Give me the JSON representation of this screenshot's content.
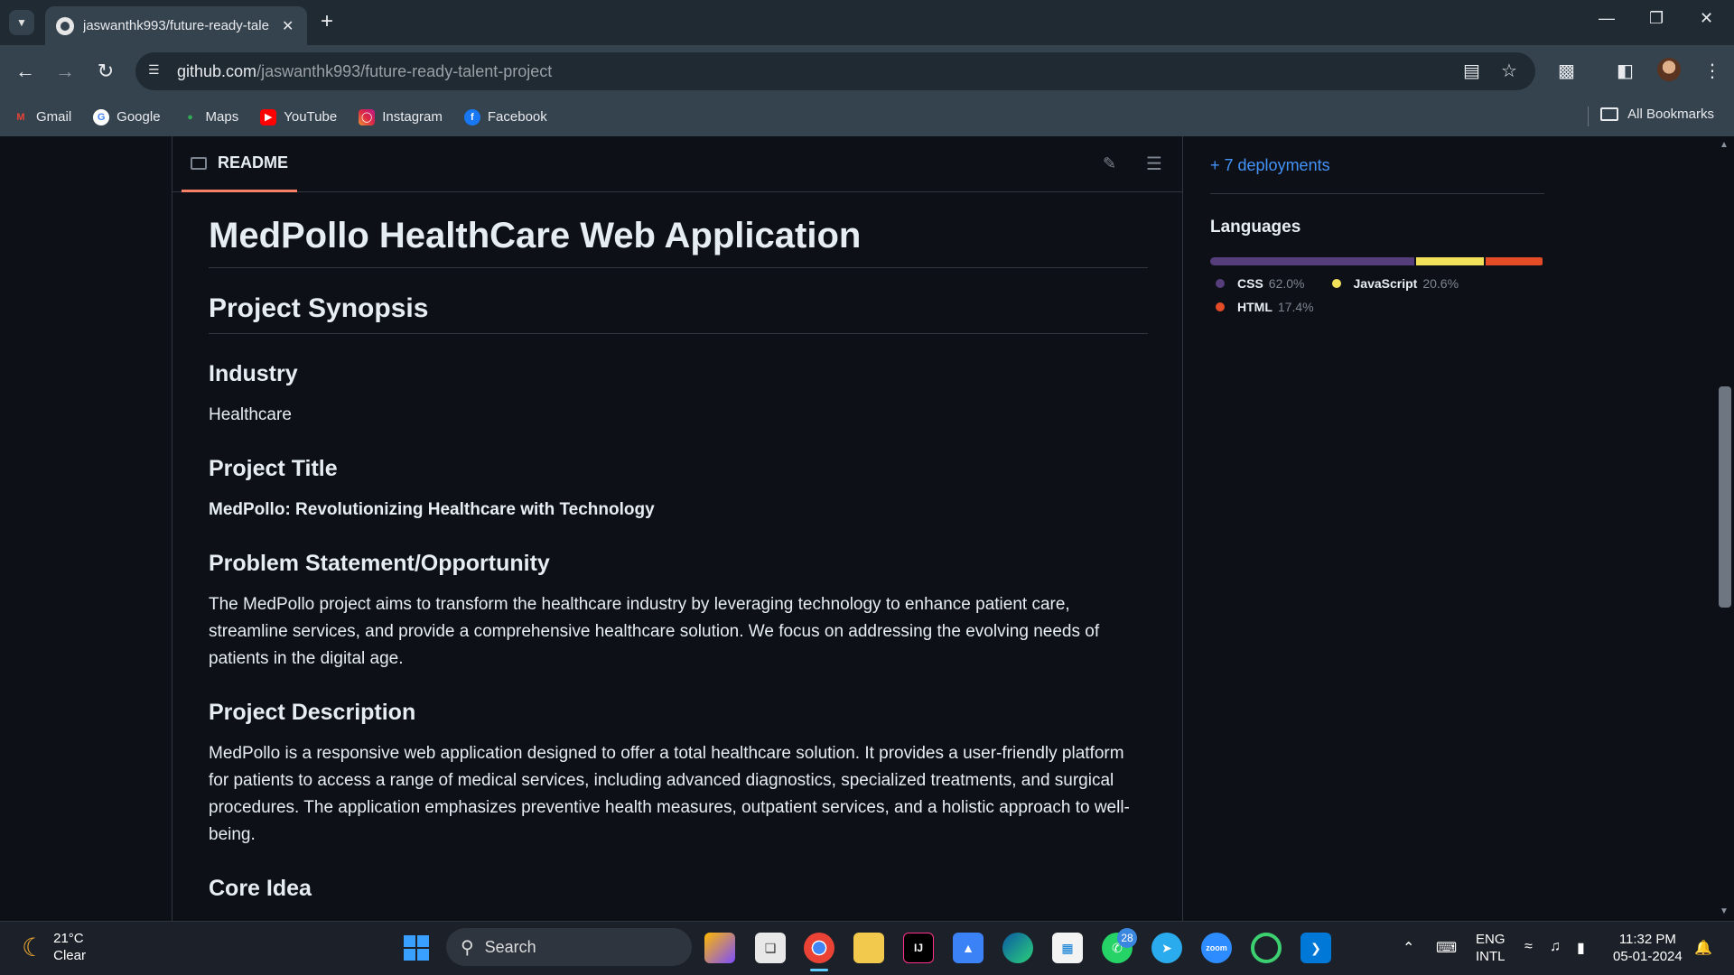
{
  "browser": {
    "tab_title": "jaswanthk993/future-ready-tale",
    "url_domain": "github.com",
    "url_path": "/jaswanthk993/future-ready-talent-project",
    "bookmarks": [
      "Gmail",
      "Google",
      "Maps",
      "YouTube",
      "Instagram",
      "Facebook"
    ],
    "all_bookmarks": "All Bookmarks"
  },
  "readme": {
    "tab_label": "README",
    "h1": "MedPollo HealthCare Web Application",
    "synopsis": "Project Synopsis",
    "industry_heading": "Industry",
    "industry_value": "Healthcare",
    "title_heading": "Project Title",
    "title_value": "MedPollo: Revolutionizing Healthcare with Technology",
    "problem_heading": "Problem Statement/Opportunity",
    "problem_text": "The MedPollo project aims to transform the healthcare industry by leveraging technology to enhance patient care, streamline services, and provide a comprehensive healthcare solution. We focus on addressing the evolving needs of patients in the digital age.",
    "description_heading": "Project Description",
    "description_text": "MedPollo is a responsive web application designed to offer a total healthcare solution. It provides a user-friendly platform for patients to access a range of medical services, including advanced diagnostics, specialized treatments, and surgical procedures. The application emphasizes preventive health measures, outpatient services, and a holistic approach to well-being.",
    "core_heading": "Core Idea"
  },
  "sidebar": {
    "deployments": "+ 7 deployments",
    "languages_title": "Languages",
    "languages": [
      {
        "name": "CSS",
        "pct": "62.0%",
        "value": 62.0,
        "color": "#563d7c"
      },
      {
        "name": "JavaScript",
        "pct": "20.6%",
        "value": 20.6,
        "color": "#f1e05a"
      },
      {
        "name": "HTML",
        "pct": "17.4%",
        "value": 17.4,
        "color": "#e34c26"
      }
    ]
  },
  "taskbar": {
    "temperature": "21°C",
    "weather": "Clear",
    "search_placeholder": "Search",
    "whatsapp_badge": "28",
    "lang_top": "ENG",
    "lang_bottom": "INTL",
    "time": "11:32 PM",
    "date": "05-01-2024"
  }
}
